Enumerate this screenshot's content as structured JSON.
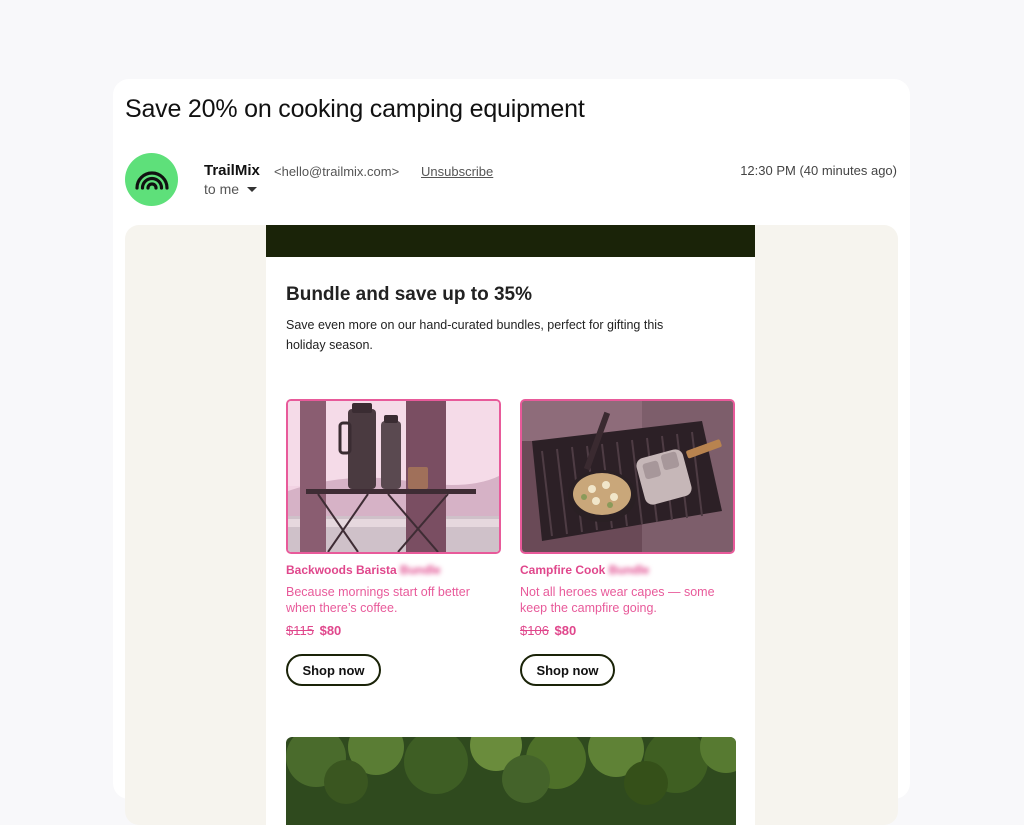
{
  "email": {
    "subject": "Save 20% on cooking camping equipment",
    "sender_name": "TrailMix",
    "sender_email": "<hello@trailmix.com>",
    "unsubscribe_label": "Unsubscribe",
    "recipient_label": "to me",
    "timestamp": "12:30 PM (40 minutes ago)",
    "avatar_icon": "rainbow-arc-icon",
    "avatar_color": "#5ee07a"
  },
  "newsletter": {
    "header_color": "#1a2308",
    "headline": "Bundle and save up to 35%",
    "intro": "Save even more on our hand-curated bundles, perfect for gifting this holiday season.",
    "accent_color": "#e85a9a",
    "products": [
      {
        "name_visible": "Backwoods Barista",
        "name_blurred": " Bundle",
        "description": "Because mornings start off better when there’s coffee.",
        "old_price": "$115",
        "new_price": "$80",
        "cta": "Shop now",
        "image_icon": "camping-thermos-photo"
      },
      {
        "name_visible": "Campfire Cook",
        "name_blurred": " Bundle",
        "description": "Not all heroes wear capes — some keep the campfire going.",
        "old_price": "$106",
        "new_price": "$80",
        "cta": "Shop now",
        "image_icon": "campfire-grill-photo"
      }
    ],
    "banner_icon": "forest-photo"
  }
}
